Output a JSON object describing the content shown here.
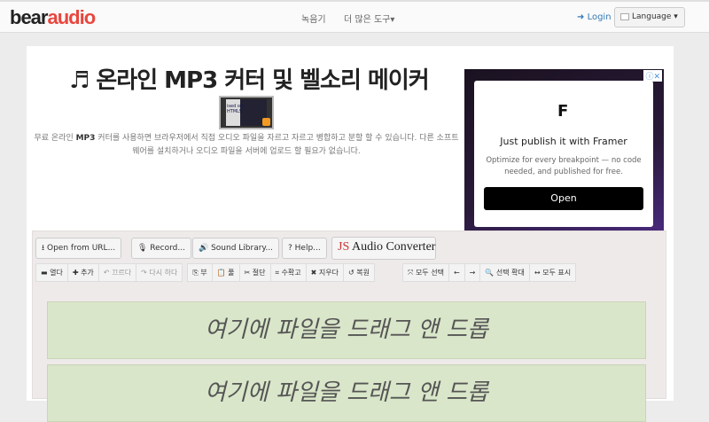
{
  "header": {
    "logo_left": "bear",
    "logo_right": "audio",
    "nav": [
      "녹음기",
      "더 많은 도구▾"
    ],
    "login": "Login",
    "language": "Language ▾"
  },
  "main": {
    "title": "♬ 온라인 MP3 커터 및 벨소리 메이커",
    "video_caption": "ised on HTML5",
    "desc_pre": "무료 온라인 ",
    "desc_bold": "MP3",
    "desc_post": " 커터를 사용하면 브라우저에서 직접 오디오 파일을 자르고 자르고 병합하고 분할 할 수 있습니다. 다른 소프트웨어를 설치하거나 오디오 파일을 서버에 업로드 할 필요가 없습니다."
  },
  "ad": {
    "headline": "Just publish it with Framer",
    "body": "Optimize for every breakpoint — no code needed, and published for free.",
    "cta": "Open",
    "info": "ⓘ✕"
  },
  "toolbar": {
    "open_url": "⭳ Open from URL...",
    "record": "🎙 Record...",
    "library": "🔊 Sound Library...",
    "help": "? Help...",
    "converter_js": "JS",
    "converter": " Audio Converter"
  },
  "edit": [
    {
      "label": "▬ 열다",
      "d": false
    },
    {
      "label": "✚ 추가",
      "d": false
    },
    {
      "label": "↶ 끄르다",
      "d": true
    },
    {
      "label": "↷ 다시 하다",
      "d": true
    },
    {
      "label": "⎘ 부",
      "d": false
    },
    {
      "label": "📋 풀",
      "d": false
    },
    {
      "label": "✂ 절단",
      "d": false
    },
    {
      "label": "⌗ 수확고",
      "d": false
    },
    {
      "label": "✖ 지우다",
      "d": false
    },
    {
      "label": "↺ 복원",
      "d": false
    }
  ],
  "select": [
    {
      "label": "⤧ 모두 선택"
    },
    {
      "label": "←"
    },
    {
      "label": "→"
    },
    {
      "label": "🔍 선택 확대"
    },
    {
      "label": "↔ 모두 표시"
    }
  ],
  "dropzone": "여기에 파일을 드래그 앤 드롭"
}
